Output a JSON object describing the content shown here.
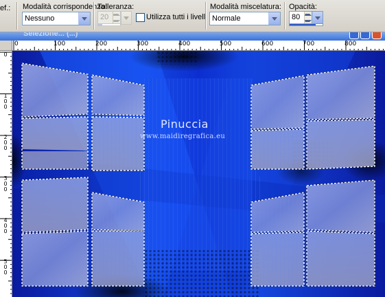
{
  "toolbar": {
    "left_fragment": "ef.:",
    "match_mode": {
      "label": "Modalità corrispondenza:",
      "value": "Nessuno"
    },
    "tolerance": {
      "label": "Tolleranza:",
      "value": "20"
    },
    "use_all_layers": {
      "label": "Utilizza tutti i livelli",
      "checked": false
    },
    "blend_mode": {
      "label": "Modalità miscelatura:",
      "value": "Normale"
    },
    "opacity": {
      "label": "Opacità:",
      "value": "80",
      "fraction": 0.8
    }
  },
  "document": {
    "title": "Selezione... (...)",
    "accent": "#3b72d8"
  },
  "rulers": {
    "top_labels": [
      "0",
      "100",
      "200",
      "300",
      "400",
      "500",
      "600",
      "700",
      "800"
    ],
    "left_labels": [
      "0",
      "1\n0\n0",
      "2\n0\n0",
      "3\n0\n0",
      "4\n0\n0",
      "5\n0\n0"
    ]
  },
  "watermark": {
    "name": "Pinuccia",
    "url": "www.maidiregrafica.eu"
  },
  "colors": {
    "canvas_deep": "#0a1fa6",
    "canvas_bright": "#1a5cff",
    "selection_marquee": "#ffffff"
  }
}
